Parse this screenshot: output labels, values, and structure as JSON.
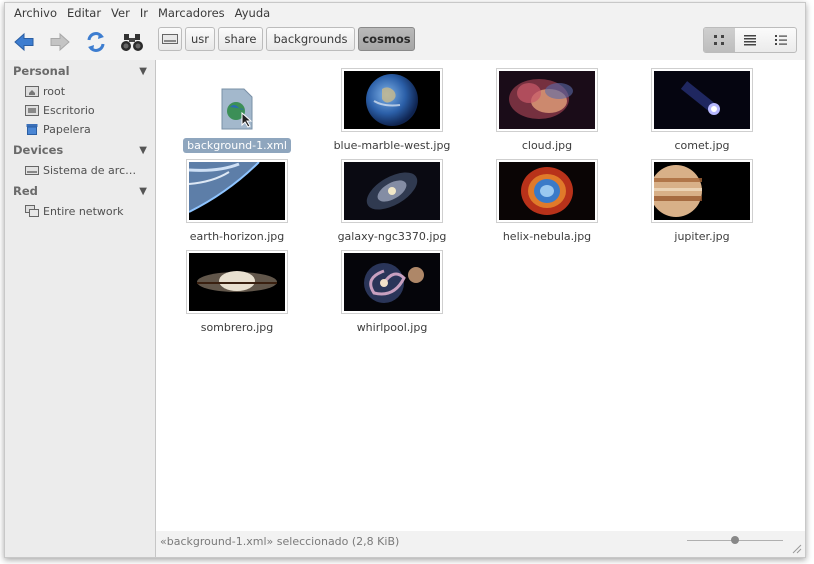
{
  "menu": [
    "Archivo",
    "Editar",
    "Ver",
    "Ir",
    "Marcadores",
    "Ayuda"
  ],
  "breadcrumbs": [
    "usr",
    "share",
    "backgrounds",
    "cosmos"
  ],
  "sidebar": {
    "sections": [
      {
        "title": "Personal",
        "items": [
          {
            "label": "root",
            "icon": "home-folder-icon"
          },
          {
            "label": "Escritorio",
            "icon": "desktop-folder-icon"
          },
          {
            "label": "Papelera",
            "icon": "trash-icon"
          }
        ]
      },
      {
        "title": "Devices",
        "items": [
          {
            "label": "Sistema de arc…",
            "icon": "drive-icon"
          }
        ]
      },
      {
        "title": "Red",
        "items": [
          {
            "label": "Entire network",
            "icon": "network-icon"
          }
        ]
      }
    ]
  },
  "files": [
    {
      "name": "background-1.xml",
      "selected": true
    },
    {
      "name": "blue-marble-west.jpg"
    },
    {
      "name": "cloud.jpg"
    },
    {
      "name": "comet.jpg"
    },
    {
      "name": "earth-horizon.jpg"
    },
    {
      "name": "galaxy-ngc3370.jpg"
    },
    {
      "name": "helix-nebula.jpg"
    },
    {
      "name": "jupiter.jpg"
    },
    {
      "name": "sombrero.jpg"
    },
    {
      "name": "whirlpool.jpg"
    }
  ],
  "status": "«background-1.xml» seleccionado (2,8 KiB)",
  "colors": {
    "accent": "#3a7bd5",
    "selection": "#8fa6be"
  }
}
